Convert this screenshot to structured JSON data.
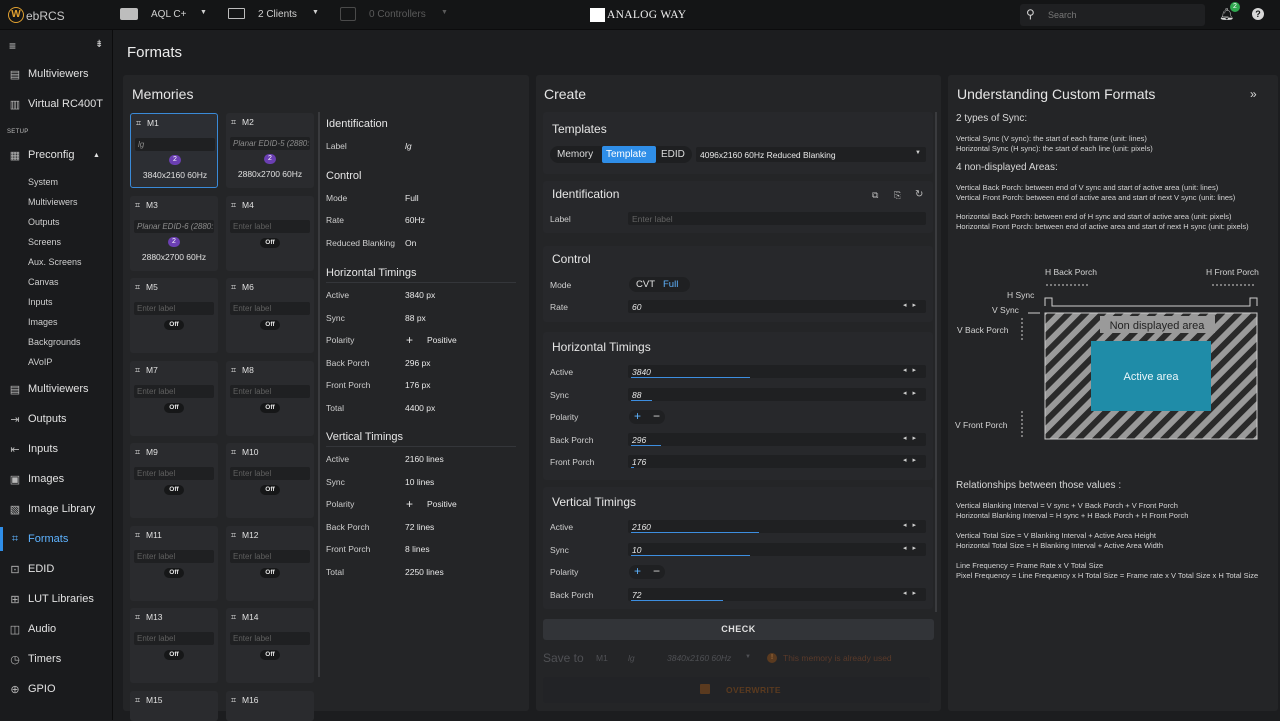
{
  "topbar": {
    "logo_letter": "W",
    "logo_text": "ebRCS",
    "device": "AQL C+",
    "clients": "2 Clients",
    "controllers": "0 Controllers",
    "brand": "ANALOG WAY",
    "search_placeholder": "Search",
    "notif_count": "2"
  },
  "sidebar": {
    "top": [
      {
        "label": "Multiviewers",
        "icon": "grid-icon"
      },
      {
        "label": "Virtual RC400T",
        "icon": "remote-icon"
      }
    ],
    "setup_header": "SETUP",
    "preconfig": "Preconfig",
    "sub": [
      "System",
      "Multiviewers",
      "Outputs",
      "Screens",
      "Aux. Screens",
      "Canvas",
      "Inputs",
      "Images",
      "Backgrounds",
      "AVoIP"
    ],
    "bottom": [
      {
        "label": "Multiviewers"
      },
      {
        "label": "Outputs"
      },
      {
        "label": "Inputs"
      },
      {
        "label": "Images"
      },
      {
        "label": "Image Library"
      },
      {
        "label": "Formats"
      },
      {
        "label": "EDID"
      },
      {
        "label": "LUT Libraries"
      },
      {
        "label": "Audio"
      },
      {
        "label": "Timers"
      },
      {
        "label": "GPIO"
      }
    ]
  },
  "page_title": "Formats",
  "memories": {
    "title": "Memories",
    "cards": [
      {
        "name": "M1",
        "label": "lg",
        "badge": "2",
        "res": "3840x2160 60Hz",
        "state": "res"
      },
      {
        "name": "M2",
        "label": "Planar EDID-5 (2880:",
        "badge": "2",
        "res": "2880x2700 60Hz",
        "state": "res"
      },
      {
        "name": "M3",
        "label": "Planar EDID-6 (2880:",
        "badge": "2",
        "res": "2880x2700 60Hz",
        "state": "res"
      },
      {
        "name": "M4",
        "label": "Enter label",
        "state": "Off"
      },
      {
        "name": "M5",
        "label": "Enter label",
        "state": "Off"
      },
      {
        "name": "M6",
        "label": "Enter label",
        "state": "Off"
      },
      {
        "name": "M7",
        "label": "Enter label",
        "state": "Off"
      },
      {
        "name": "M8",
        "label": "Enter label",
        "state": "Off"
      },
      {
        "name": "M9",
        "label": "Enter label",
        "state": "Off"
      },
      {
        "name": "M10",
        "label": "Enter label",
        "state": "Off"
      },
      {
        "name": "M11",
        "label": "Enter label",
        "state": "Off"
      },
      {
        "name": "M12",
        "label": "Enter label",
        "state": "Off"
      },
      {
        "name": "M13",
        "label": "Enter label",
        "state": "Off"
      },
      {
        "name": "M14",
        "label": "Enter label",
        "state": "Off"
      },
      {
        "name": "M15"
      },
      {
        "name": "M16"
      }
    ]
  },
  "details": {
    "identification": "Identification",
    "label_l": "Label",
    "label_v": "lg",
    "control": "Control",
    "mode_l": "Mode",
    "mode_v": "Full",
    "rate_l": "Rate",
    "rate_v": "60Hz",
    "rb_l": "Reduced Blanking",
    "rb_v": "On",
    "htitle": "Horizontal Timings",
    "h": [
      {
        "l": "Active",
        "v": "3840 px"
      },
      {
        "l": "Sync",
        "v": "88 px"
      },
      {
        "l": "Polarity",
        "v": "Positive"
      },
      {
        "l": "Back Porch",
        "v": "296 px"
      },
      {
        "l": "Front Porch",
        "v": "176 px"
      },
      {
        "l": "Total",
        "v": "4400 px"
      }
    ],
    "vtitle": "Vertical Timings",
    "v": [
      {
        "l": "Active",
        "v": "2160 lines"
      },
      {
        "l": "Sync",
        "v": "10 lines"
      },
      {
        "l": "Polarity",
        "v": "Positive"
      },
      {
        "l": "Back Porch",
        "v": "72 lines"
      },
      {
        "l": "Front Porch",
        "v": "8 lines"
      },
      {
        "l": "Total",
        "v": "2250 lines"
      }
    ]
  },
  "create": {
    "title": "Create",
    "templates": "Templates",
    "tabs": [
      "Memory",
      "Template",
      "EDID"
    ],
    "template_value": "4096x2160 60Hz Reduced Blanking",
    "identification": "Identification",
    "label_l": "Label",
    "label_ph": "Enter label",
    "control": "Control",
    "mode_l": "Mode",
    "mode_opts": [
      "CVT",
      "Full"
    ],
    "rate_l": "Rate",
    "rate_v": "60",
    "htitle": "Horizontal Timings",
    "h": [
      {
        "l": "Active",
        "v": "3840",
        "fill": 0.4
      },
      {
        "l": "Sync",
        "v": "88",
        "fill": 0.07
      },
      {
        "l": "Polarity",
        "v": ""
      },
      {
        "l": "Back Porch",
        "v": "296",
        "fill": 0.1
      },
      {
        "l": "Front Porch",
        "v": "176",
        "fill": 0.01
      }
    ],
    "vtitle": "Vertical Timings",
    "v": [
      {
        "l": "Active",
        "v": "2160",
        "fill": 0.43
      },
      {
        "l": "Sync",
        "v": "10",
        "fill": 0.4
      },
      {
        "l": "Polarity",
        "v": ""
      },
      {
        "l": "Back Porch",
        "v": "72",
        "fill": 0.31
      }
    ],
    "check": "CHECK",
    "save_to": "Save to",
    "save_mem": "M1",
    "save_label": "lg",
    "save_fmt": "3840x2160 60Hz",
    "warning": "This memory is already used",
    "overwrite": "OVERWRITE"
  },
  "explain": {
    "title": "Understanding Custom Formats",
    "sync_h": "2 types of Sync:",
    "sync": [
      "Vertical Sync (V sync): the start of each frame (unit: lines)",
      "Horizontal Sync (H sync): the start of each line (unit: pixels)"
    ],
    "areas_h": "4 non-displayed Areas:",
    "areas": [
      "Vertical Back Porch: between end of V sync and start of active area (unit: lines)",
      "Vertical Front Porch: between end of active area and start of next V sync (unit: lines)",
      "Horizontal Back Porch: between end of H sync and start of active area (unit: pixels)",
      "Horizontal Front Porch: between end of active area and start of next H sync (unit: pixels)"
    ],
    "diagram": {
      "hbp": "H Back Porch",
      "hfp": "H Front Porch",
      "hsync": "H Sync",
      "vsync": "V Sync",
      "vbp": "V Back Porch",
      "vfp": "V Front Porch",
      "nda": "Non displayed area",
      "active": "Active area"
    },
    "rel_h": "Relationships between those values :",
    "rel": [
      "Vertical Blanking Interval = V sync + V Back Porch + V Front Porch",
      "Horizontal Blanking Interval = H sync + H Back Porch + H Front Porch",
      "Vertical Total Size = V Blanking Interval + Active Area Height",
      "Horizontal Total Size = H Blanking Interval + Active Area Width",
      "Line Frequency = Frame Rate x V Total Size",
      "Pixel Frequency = Line Frequency x H Total Size = Frame rate x V Total Size x H Total Size"
    ]
  }
}
